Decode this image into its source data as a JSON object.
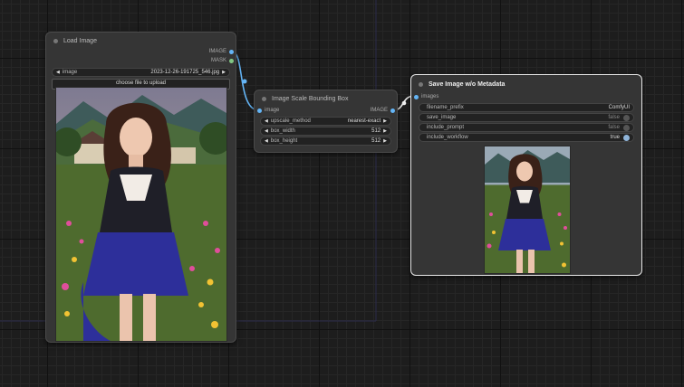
{
  "nodes": {
    "load_image": {
      "title": "Load Image",
      "outputs": [
        "IMAGE",
        "MASK"
      ],
      "image_widget": {
        "label": "image",
        "value": "2023-12-26-191725_546.jpg"
      },
      "upload_button": "choose file to upload"
    },
    "scale_box": {
      "title": "Image Scale Bounding Box",
      "input": "image",
      "output": "IMAGE",
      "widgets": [
        {
          "label": "upscale_method",
          "value": "nearest-exact"
        },
        {
          "label": "box_width",
          "value": "512"
        },
        {
          "label": "box_height",
          "value": "512"
        }
      ]
    },
    "save_image": {
      "title": "Save Image w/o Metadata",
      "input": "images",
      "filename_prefix": {
        "label": "filename_prefix",
        "value": "ComfyUI"
      },
      "toggles": [
        {
          "label": "save_image",
          "value": "false"
        },
        {
          "label": "include_prompt",
          "value": "false"
        },
        {
          "label": "include_workflow",
          "value": "true"
        }
      ]
    }
  },
  "colors": {
    "image_socket": "#64b5f6",
    "mask_socket": "#81c784",
    "link": "#64b5f6"
  },
  "icons": {
    "left_arrow": "◀",
    "right_arrow": "▶"
  }
}
